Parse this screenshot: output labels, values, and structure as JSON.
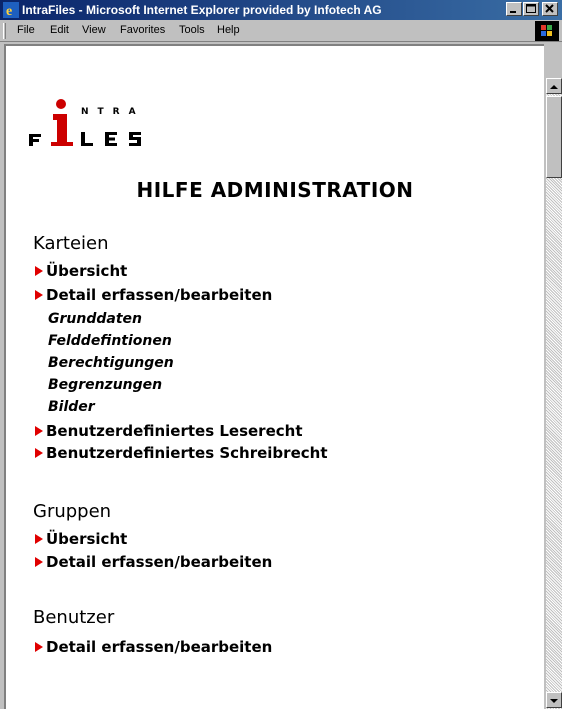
{
  "window": {
    "title": "IntraFiles - Microsoft Internet Explorer provided by Infotech AG",
    "controls": [
      "minimize-icon",
      "maximize-icon",
      "close-icon"
    ]
  },
  "menu": {
    "items": [
      "File",
      "Edit",
      "View",
      "Favorites",
      "Tools",
      "Help"
    ]
  },
  "logo": {
    "letters_top": "N T R A",
    "letters_bottom": "F L E S",
    "accent_color": "#cc0000"
  },
  "page": {
    "heading": "HILFE ADMINISTRATION",
    "sections": [
      {
        "title": "Karteien",
        "entries": [
          {
            "label": "Übersicht",
            "type": "link"
          },
          {
            "label": "Detail erfassen/bearbeiten",
            "type": "link"
          },
          {
            "label": "Grunddaten",
            "type": "sub"
          },
          {
            "label": "Felddefintionen",
            "type": "sub"
          },
          {
            "label": "Berechtigungen",
            "type": "sub"
          },
          {
            "label": "Begrenzungen",
            "type": "sub"
          },
          {
            "label": "Bilder",
            "type": "sub"
          },
          {
            "label": "Benutzerdefiniertes Leserecht",
            "type": "link"
          },
          {
            "label": "Benutzerdefiniertes Schreibrecht",
            "type": "link"
          }
        ]
      },
      {
        "title": "Gruppen",
        "entries": [
          {
            "label": "Übersicht",
            "type": "link"
          },
          {
            "label": "Detail erfassen/bearbeiten",
            "type": "link"
          }
        ]
      },
      {
        "title": "Benutzer",
        "entries": [
          {
            "label": "Detail erfassen/bearbeiten",
            "type": "link"
          }
        ]
      }
    ]
  },
  "colors": {
    "titlebar": "#0a246a",
    "arrow": "#e00000",
    "chrome": "#c0c0c0"
  }
}
